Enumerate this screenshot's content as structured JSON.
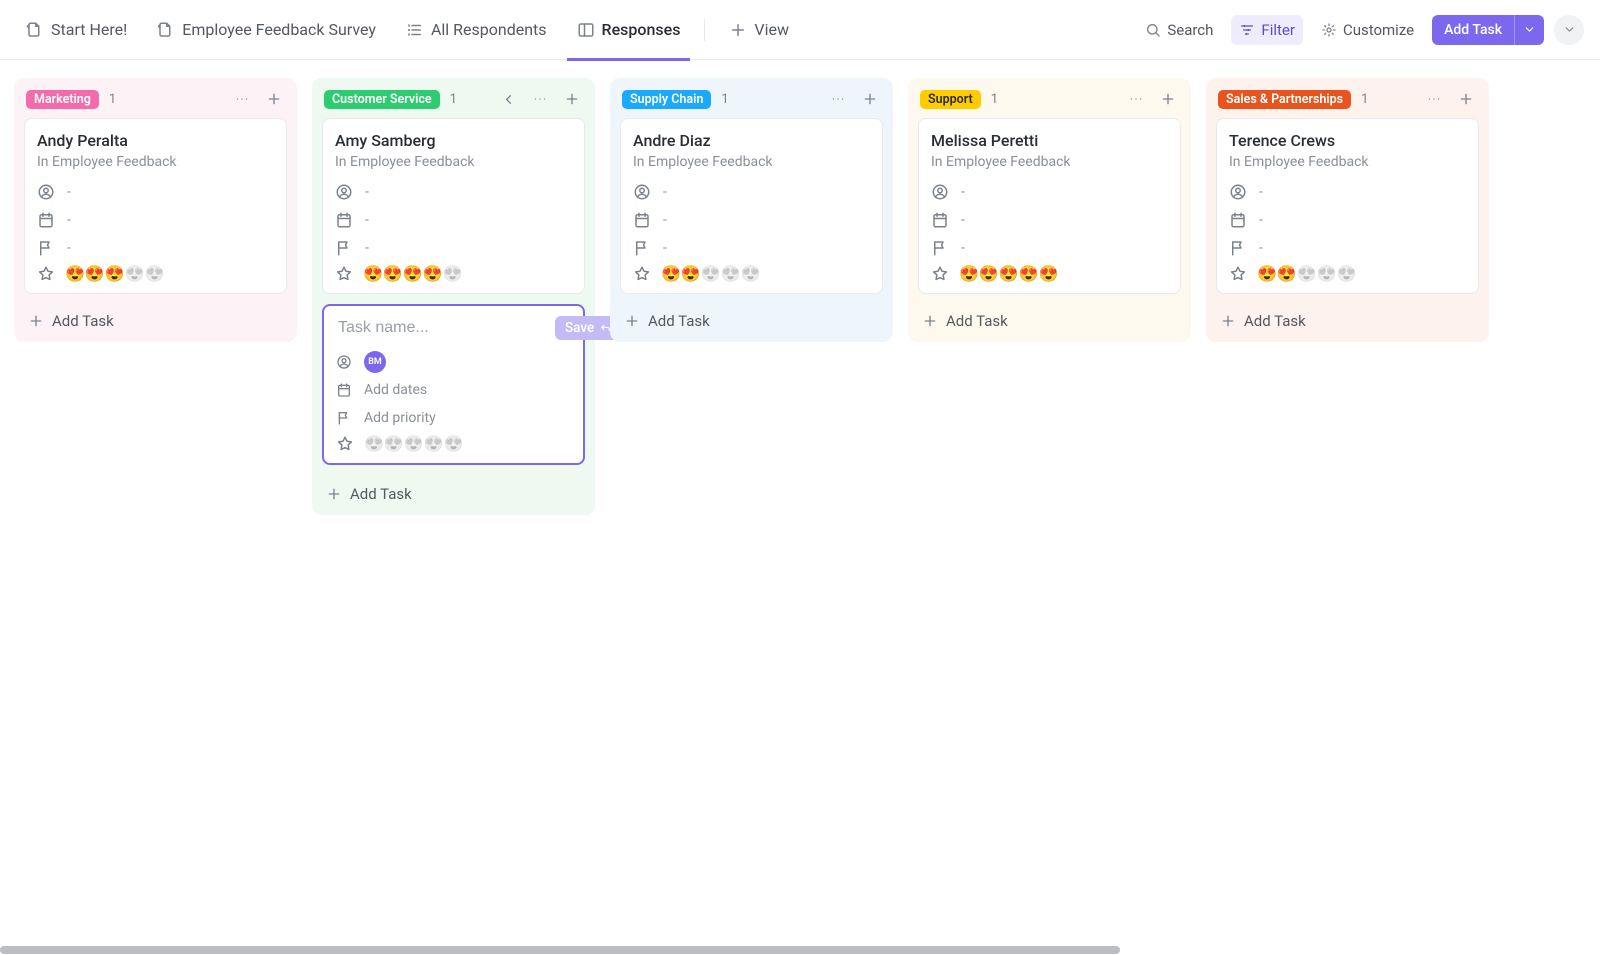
{
  "nav": {
    "start": "Start Here!",
    "survey": "Employee Feedback Survey",
    "respondents": "All Respondents",
    "responses": "Responses",
    "view": "View"
  },
  "toolbar": {
    "search": "Search",
    "filter": "Filter",
    "customize": "Customize",
    "add_task": "Add Task"
  },
  "columns": [
    {
      "key": "marketing",
      "label": "Marketing",
      "count": "1",
      "tag_class": "tag-marketing",
      "col_class": "marketing",
      "active": false
    },
    {
      "key": "customer",
      "label": "Customer Service",
      "count": "1",
      "tag_class": "tag-customer",
      "col_class": "customer",
      "active": true
    },
    {
      "key": "supply",
      "label": "Supply Chain",
      "count": "1",
      "tag_class": "tag-supply",
      "col_class": "supply",
      "active": false
    },
    {
      "key": "support",
      "label": "Support",
      "count": "1",
      "tag_class": "tag-support",
      "col_class": "support",
      "active": false
    },
    {
      "key": "sales",
      "label": "Sales & Partnerships",
      "count": "1",
      "tag_class": "tag-sales",
      "col_class": "sales",
      "active": false
    }
  ],
  "cards": {
    "marketing": {
      "title": "Andy Peralta",
      "sub": "In Employee Feedback",
      "rating": 3
    },
    "customer": {
      "title": "Amy Samberg",
      "sub": "In Employee Feedback",
      "rating": 4
    },
    "supply": {
      "title": "Andre Diaz",
      "sub": "In Employee Feedback",
      "rating": 2
    },
    "support": {
      "title": "Melissa Peretti",
      "sub": "In Employee Feedback",
      "rating": 5
    },
    "sales": {
      "title": "Terence Crews",
      "sub": "In Employee Feedback",
      "rating": 2
    }
  },
  "new_task": {
    "placeholder": "Task name...",
    "save": "Save",
    "avatar_initials": "BM",
    "add_dates": "Add dates",
    "add_priority": "Add priority"
  },
  "common": {
    "add_task": "Add Task",
    "dash": "-"
  }
}
